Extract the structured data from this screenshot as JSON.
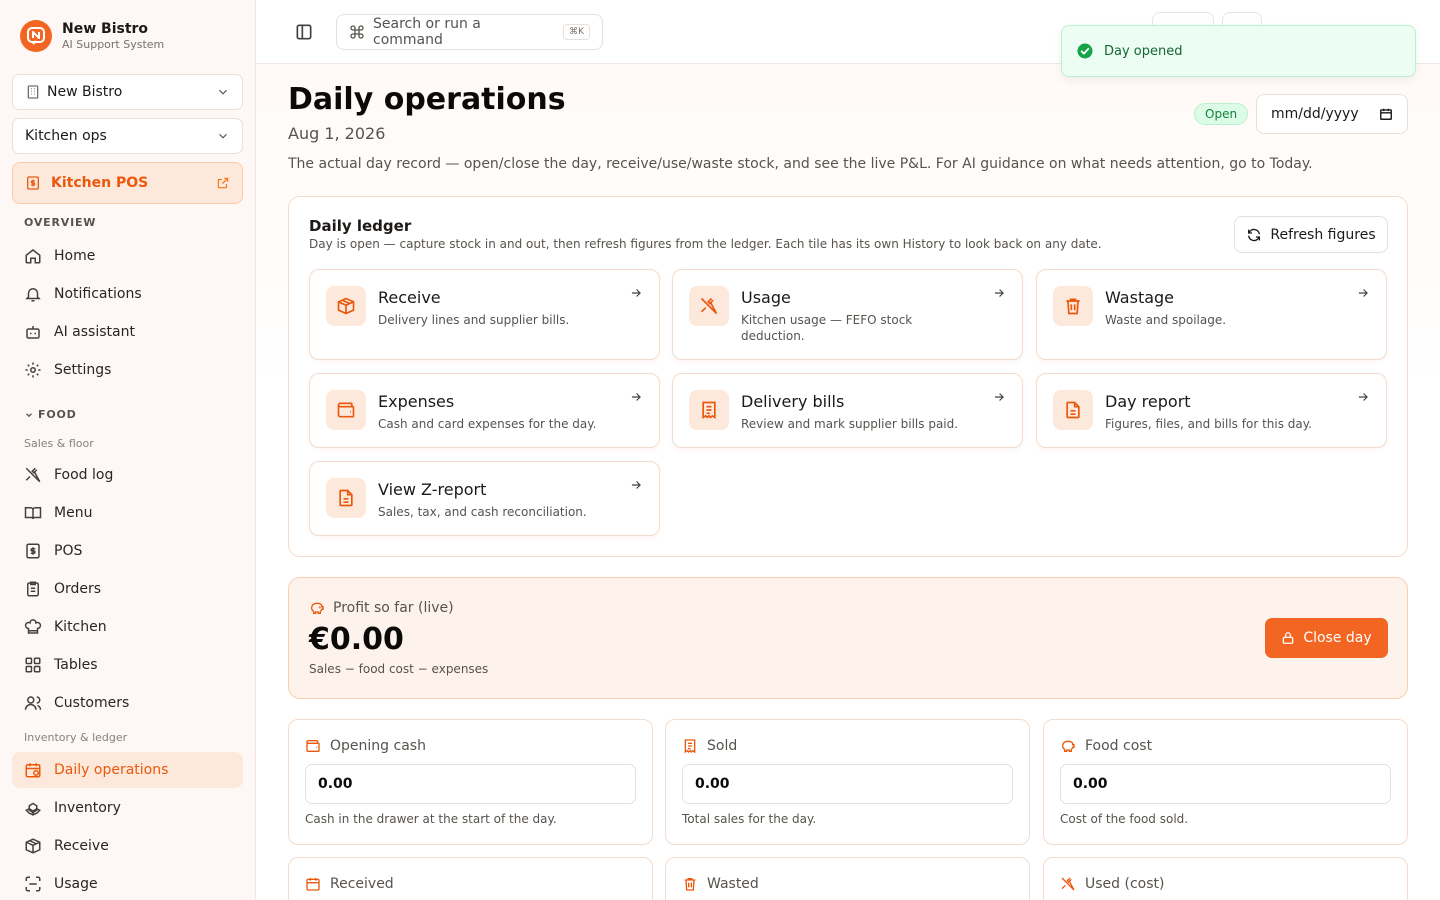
{
  "brand": {
    "name": "New Bistro",
    "subtitle": "AI Support System",
    "logo_letter": "N"
  },
  "sidebar": {
    "restaurant_select": "New Bistro",
    "mode_select": "Kitchen ops",
    "pos_button": "Kitchen POS",
    "overview_title": "OVERVIEW",
    "overview_items": [
      "Home",
      "Notifications",
      "AI assistant",
      "Settings"
    ],
    "food_title": "FOOD",
    "sales_floor_title": "Sales & floor",
    "sales_items": [
      "Food log",
      "Menu",
      "POS",
      "Orders",
      "Kitchen",
      "Tables",
      "Customers"
    ],
    "inventory_title": "Inventory & ledger",
    "inventory_items": [
      "Daily operations",
      "Inventory",
      "Receive",
      "Usage"
    ]
  },
  "topbar": {
    "search_placeholder": "Search or run a command",
    "shortcut": "⌘K"
  },
  "toast": {
    "message": "Day opened"
  },
  "page": {
    "title": "Daily operations",
    "date": "Aug 1, 2026",
    "description": "The actual day record — open/close the day, receive/use/waste stock, and see the live P&L. For AI guidance on what needs attention, go to Today.",
    "status": "Open",
    "date_input_placeholder": "mm/dd/yyyy"
  },
  "ledger": {
    "title": "Daily ledger",
    "description": "Day is open — capture stock in and out, then refresh figures from the ledger. Each tile has its own History to look back on any date.",
    "refresh_label": "Refresh figures",
    "tiles": [
      {
        "title": "Receive",
        "desc": "Delivery lines and supplier bills.",
        "icon": "package-icon"
      },
      {
        "title": "Usage",
        "desc": "Kitchen usage — FEFO stock deduction.",
        "icon": "utensils-crossed-icon"
      },
      {
        "title": "Wastage",
        "desc": "Waste and spoilage.",
        "icon": "trash-icon"
      },
      {
        "title": "Expenses",
        "desc": "Cash and card expenses for the day.",
        "icon": "wallet-icon"
      },
      {
        "title": "Delivery bills",
        "desc": "Review and mark supplier bills paid.",
        "icon": "receipt-icon"
      },
      {
        "title": "Day report",
        "desc": "Figures, files, and bills for this day.",
        "icon": "file-text-icon"
      },
      {
        "title": "View Z-report",
        "desc": "Sales, tax, and cash reconciliation.",
        "icon": "file-text-icon"
      }
    ]
  },
  "profit": {
    "label": "Profit so far (live)",
    "value": "€0.00",
    "formula": "Sales − food cost − expenses",
    "close_label": "Close day"
  },
  "stats": [
    {
      "label": "Opening cash",
      "value": "0.00",
      "hint": "Cash in the drawer at the start of the day.",
      "icon": "wallet-icon"
    },
    {
      "label": "Sold",
      "value": "0.00",
      "hint": "Total sales for the day.",
      "icon": "receipt-icon"
    },
    {
      "label": "Food cost",
      "value": "0.00",
      "hint": "Cost of the food sold.",
      "icon": "piggy-bank-icon"
    },
    {
      "label": "Received",
      "icon": "calendar-icon"
    },
    {
      "label": "Wasted",
      "icon": "trash-icon"
    },
    {
      "label": "Used (cost)",
      "icon": "utensils-crossed-icon"
    }
  ],
  "colors": {
    "accent": "#f26522",
    "accent_light": "#fde9dc",
    "success": "#16a34a"
  }
}
